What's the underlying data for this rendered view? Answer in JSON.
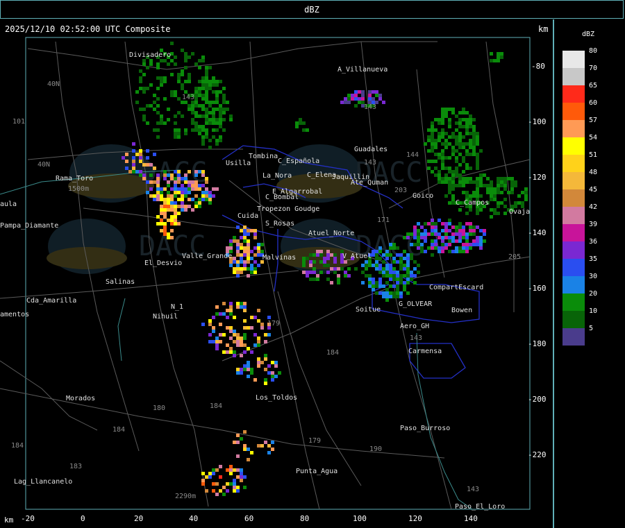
{
  "window_title": "dBZ",
  "header": {
    "timestamp_label": "2025/12/10 02:52:00 UTC Composite",
    "km_label": "km"
  },
  "axis": {
    "x_unit": "km",
    "x_ticks": [
      "-20",
      "0",
      "20",
      "40",
      "60",
      "80",
      "100",
      "120",
      "140"
    ],
    "y_ticks": [
      "-80",
      "-100",
      "-120",
      "-140",
      "-160",
      "-180",
      "-200",
      "-220"
    ]
  },
  "legend": {
    "title": "dBZ",
    "entries": [
      {
        "label": "80",
        "color": "#e8e8e8"
      },
      {
        "label": "70",
        "color": "#c8c8c8"
      },
      {
        "label": "65",
        "color": "#ff2a1a"
      },
      {
        "label": "60",
        "color": "#ff5a0a"
      },
      {
        "label": "57",
        "color": "#ff9a55"
      },
      {
        "label": "54",
        "color": "#ffff00"
      },
      {
        "label": "51",
        "color": "#ffd21a"
      },
      {
        "label": "48",
        "color": "#f4b83a"
      },
      {
        "label": "45",
        "color": "#d2883a"
      },
      {
        "label": "42",
        "color": "#d27aa0"
      },
      {
        "label": "39",
        "color": "#c8149a"
      },
      {
        "label": "36",
        "color": "#7a28d2"
      },
      {
        "label": "35",
        "color": "#2a4ef0"
      },
      {
        "label": "30",
        "color": "#1a82e6"
      },
      {
        "label": "20",
        "color": "#0a8c0a"
      },
      {
        "label": "10",
        "color": "#086408"
      },
      {
        "label": "5",
        "color": "#4a3c8c"
      }
    ]
  },
  "places": [
    {
      "name": "Divisadero",
      "x": 186,
      "y": 82
    },
    {
      "name": "A_Villanueva",
      "x": 486,
      "y": 103
    },
    {
      "name": "Guadales",
      "x": 510,
      "y": 218
    },
    {
      "name": "Tombina",
      "x": 358,
      "y": 228
    },
    {
      "name": "C_Española",
      "x": 400,
      "y": 235
    },
    {
      "name": "Usilla",
      "x": 325,
      "y": 238
    },
    {
      "name": "La_Nora",
      "x": 378,
      "y": 256
    },
    {
      "name": "C_Elena",
      "x": 442,
      "y": 255
    },
    {
      "name": "Jaquillin",
      "x": 478,
      "y": 258
    },
    {
      "name": "Ate_Quman",
      "x": 505,
      "y": 266
    },
    {
      "name": "Goico",
      "x": 594,
      "y": 285
    },
    {
      "name": "C_Campos",
      "x": 656,
      "y": 295
    },
    {
      "name": "Ovaja",
      "x": 733,
      "y": 308
    },
    {
      "name": "Rama_Toro",
      "x": 80,
      "y": 260
    },
    {
      "name": "Pampa_Diamante",
      "x": 0,
      "y": 328
    },
    {
      "name": "C_Bombal",
      "x": 382,
      "y": 287
    },
    {
      "name": "E_Algarrobal",
      "x": 392,
      "y": 279
    },
    {
      "name": "Tropezon Goudge",
      "x": 370,
      "y": 304
    },
    {
      "name": "S_Rosas",
      "x": 382,
      "y": 325
    },
    {
      "name": "Cuida",
      "x": 342,
      "y": 314
    },
    {
      "name": "Atuel_Norte",
      "x": 444,
      "y": 339
    },
    {
      "name": "V_Atuel",
      "x": 493,
      "y": 372
    },
    {
      "name": "Malvinas",
      "x": 378,
      "y": 374
    },
    {
      "name": "Valle_Grande",
      "x": 262,
      "y": 372
    },
    {
      "name": "El_Desvio",
      "x": 208,
      "y": 382
    },
    {
      "name": "Salinas",
      "x": 152,
      "y": 409
    },
    {
      "name": "CompartEscard",
      "x": 618,
      "y": 417
    },
    {
      "name": "G_OLVEAR",
      "x": 574,
      "y": 441
    },
    {
      "name": "Bowen",
      "x": 650,
      "y": 450
    },
    {
      "name": "Soitue",
      "x": 512,
      "y": 449
    },
    {
      "name": "Aero_GH",
      "x": 576,
      "y": 473
    },
    {
      "name": "Cda_Amarilla",
      "x": 38,
      "y": 436
    },
    {
      "name": "amentos",
      "x": 0,
      "y": 456
    },
    {
      "name": "Nihuil",
      "x": 220,
      "y": 459
    },
    {
      "name": "N_1",
      "x": 246,
      "y": 445
    },
    {
      "name": "Carmensa",
      "x": 588,
      "y": 509
    },
    {
      "name": "Los_Toldos",
      "x": 368,
      "y": 576
    },
    {
      "name": "Morados",
      "x": 95,
      "y": 577
    },
    {
      "name": "Paso_Burroso",
      "x": 576,
      "y": 620
    },
    {
      "name": "Punta_Agua",
      "x": 426,
      "y": 682
    },
    {
      "name": "Lag_Llancanelo",
      "x": 20,
      "y": 697
    },
    {
      "name": "Paso_El_Loro",
      "x": 655,
      "y": 733
    },
    {
      "name": "aula",
      "x": 0,
      "y": 297
    },
    {
      "name": "40N",
      "x": 68,
      "y": 124
    },
    {
      "name": "40N",
      "x": 54,
      "y": 240
    },
    {
      "name": "101",
      "x": 18,
      "y": 178
    },
    {
      "name": "143",
      "x": 262,
      "y": 143
    },
    {
      "name": "143",
      "x": 524,
      "y": 157
    },
    {
      "name": "143",
      "x": 524,
      "y": 237
    },
    {
      "name": "144",
      "x": 585,
      "y": 226
    },
    {
      "name": "203",
      "x": 568,
      "y": 277
    },
    {
      "name": "171",
      "x": 543,
      "y": 320
    },
    {
      "name": "205",
      "x": 732,
      "y": 373
    },
    {
      "name": "179",
      "x": 385,
      "y": 469
    },
    {
      "name": "184",
      "x": 470,
      "y": 511
    },
    {
      "name": "184",
      "x": 302,
      "y": 588
    },
    {
      "name": "180",
      "x": 220,
      "y": 591
    },
    {
      "name": "184",
      "x": 162,
      "y": 622
    },
    {
      "name": "184",
      "x": 16,
      "y": 645
    },
    {
      "name": "183",
      "x": 100,
      "y": 675
    },
    {
      "name": "179",
      "x": 444,
      "y": 638
    },
    {
      "name": "190",
      "x": 532,
      "y": 650
    },
    {
      "name": "143",
      "x": 590,
      "y": 490
    },
    {
      "name": "143",
      "x": 672,
      "y": 708
    },
    {
      "name": "2290m",
      "x": 252,
      "y": 718
    },
    {
      "name": "1500m",
      "x": 98,
      "y": 275
    }
  ]
}
